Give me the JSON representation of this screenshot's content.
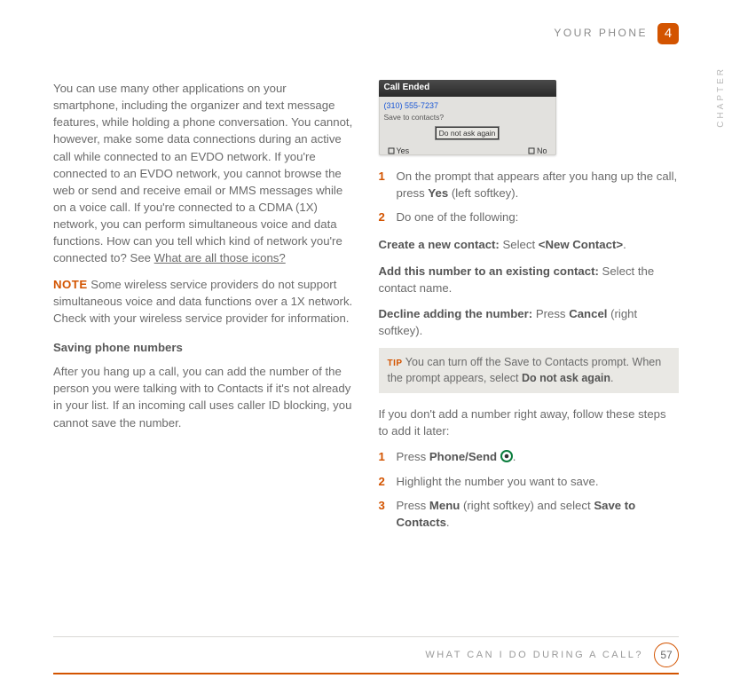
{
  "header": {
    "section": "YOUR PHONE",
    "chapter_num": "4",
    "side_label": "CHAPTER"
  },
  "left": {
    "para1a": "You can use many other applications on your smartphone, including the organizer and text message features, while holding a phone conversation. You cannot, however, make some data connections during an active call while connected to an EVDO network. If you're connected to an EVDO network, you cannot browse the web or send and receive email or MMS messages while on a voice call. If you're connected to a CDMA (1X) network, you can perform simultaneous voice and data functions. How can you tell which kind of network you're connected to? See ",
    "para1_link": "What are all those icons?",
    "note_label": "NOTE",
    "note_text": " Some wireless service providers do not support simultaneous voice and data functions over a 1X network. Check with your wireless service provider for information.",
    "section_head": "Saving phone numbers",
    "para2": "After you hang up a call, you can add the number of the person you were talking with to Contacts if it's not already in your list. If an incoming call uses caller ID blocking, you cannot save the number."
  },
  "shot": {
    "title": "Call Ended",
    "num": "(310) 555-7237",
    "sub": "Save to contacts?",
    "btn": "Do not ask again",
    "left": "Yes",
    "right": "No"
  },
  "right": {
    "step1": {
      "num": "1",
      "a": "On the prompt that appears after you hang up the call, press ",
      "b": "Yes",
      "c": " (left softkey)."
    },
    "step2": {
      "num": "2",
      "text": "Do one of the following:"
    },
    "opt1": {
      "b": "Create a new contact:",
      "t1": " Select ",
      "b2": "<New Contact>",
      "t2": "."
    },
    "opt2": {
      "b": "Add this number to an existing contact:",
      "t": " Select the contact name."
    },
    "opt3": {
      "b": "Decline adding the number:",
      "t1": " Press ",
      "b2": "Cancel",
      "t2": " (right softkey)."
    },
    "tip_label": "TIP",
    "tip_a": " You can turn off the Save to Contacts prompt. When the prompt appears, select ",
    "tip_b": "Do not ask again",
    "tip_c": ".",
    "after": "If you don't add a number right away, follow these steps to add it later:",
    "s1": {
      "num": "1",
      "a": "Press ",
      "b": "Phone/Send",
      "c": " ",
      "d": "."
    },
    "s2": {
      "num": "2",
      "t": "Highlight the number you want to save."
    },
    "s3": {
      "num": "3",
      "a": "Press ",
      "b": "Menu",
      "c": " (right softkey) and select ",
      "d": "Save to Contacts",
      "e": "."
    }
  },
  "footer": {
    "title": "WHAT CAN I DO DURING A CALL?",
    "page": "57"
  }
}
